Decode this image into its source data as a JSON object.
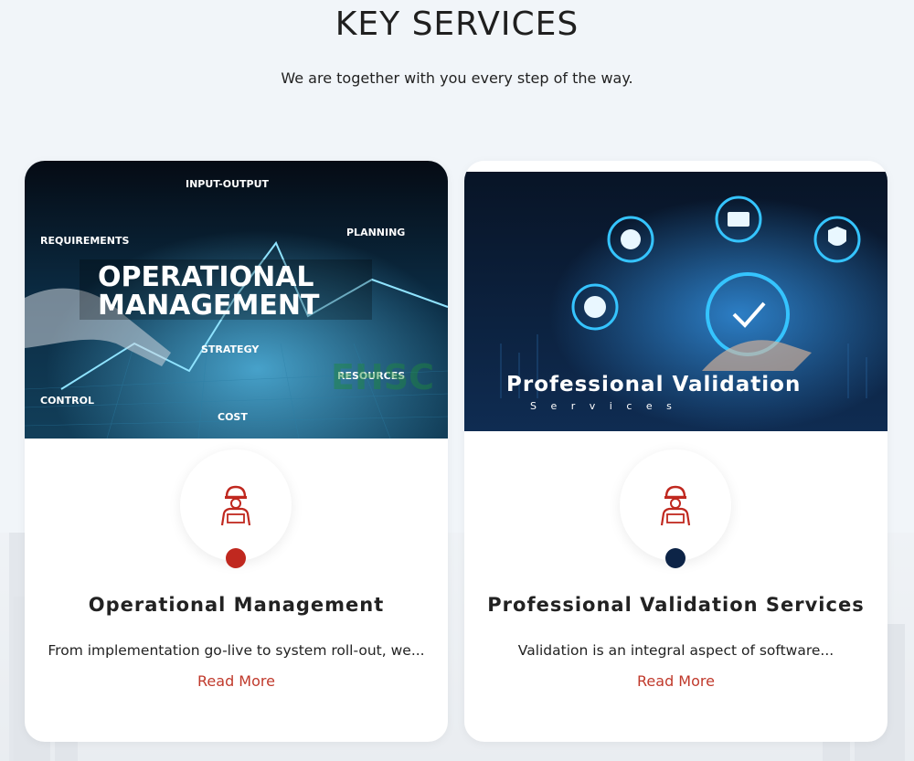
{
  "header": {
    "title": "KEY SERVICES",
    "subtitle": "We are together with you every step of the way."
  },
  "cards": [
    {
      "banner": {
        "heading_line1": "OPERATIONAL",
        "heading_line2": "MANAGEMENT",
        "tags": [
          "INPUT-OUTPUT",
          "REQUIREMENTS",
          "PLANNING",
          "STRATEGY",
          "RESOURCES",
          "CONTROL",
          "COST"
        ]
      },
      "icon": "worker-engineer-icon",
      "dot_color": "#c0281f",
      "name": "Operational Management",
      "description": "From implementation go-live to system roll-out, we...",
      "link_label": "Read More"
    },
    {
      "banner": {
        "heading": "Professional Validation",
        "subheading": "S e r v i c e s"
      },
      "icon": "worker-engineer-icon",
      "dot_color": "#0d2447",
      "name": "Professional Validation Services",
      "description": "Validation is an integral aspect of software...",
      "link_label": "Read More"
    }
  ],
  "watermark": "EHSCity",
  "colors": {
    "accent_red": "#c0392b",
    "page_bg": "#f1f5f9"
  }
}
